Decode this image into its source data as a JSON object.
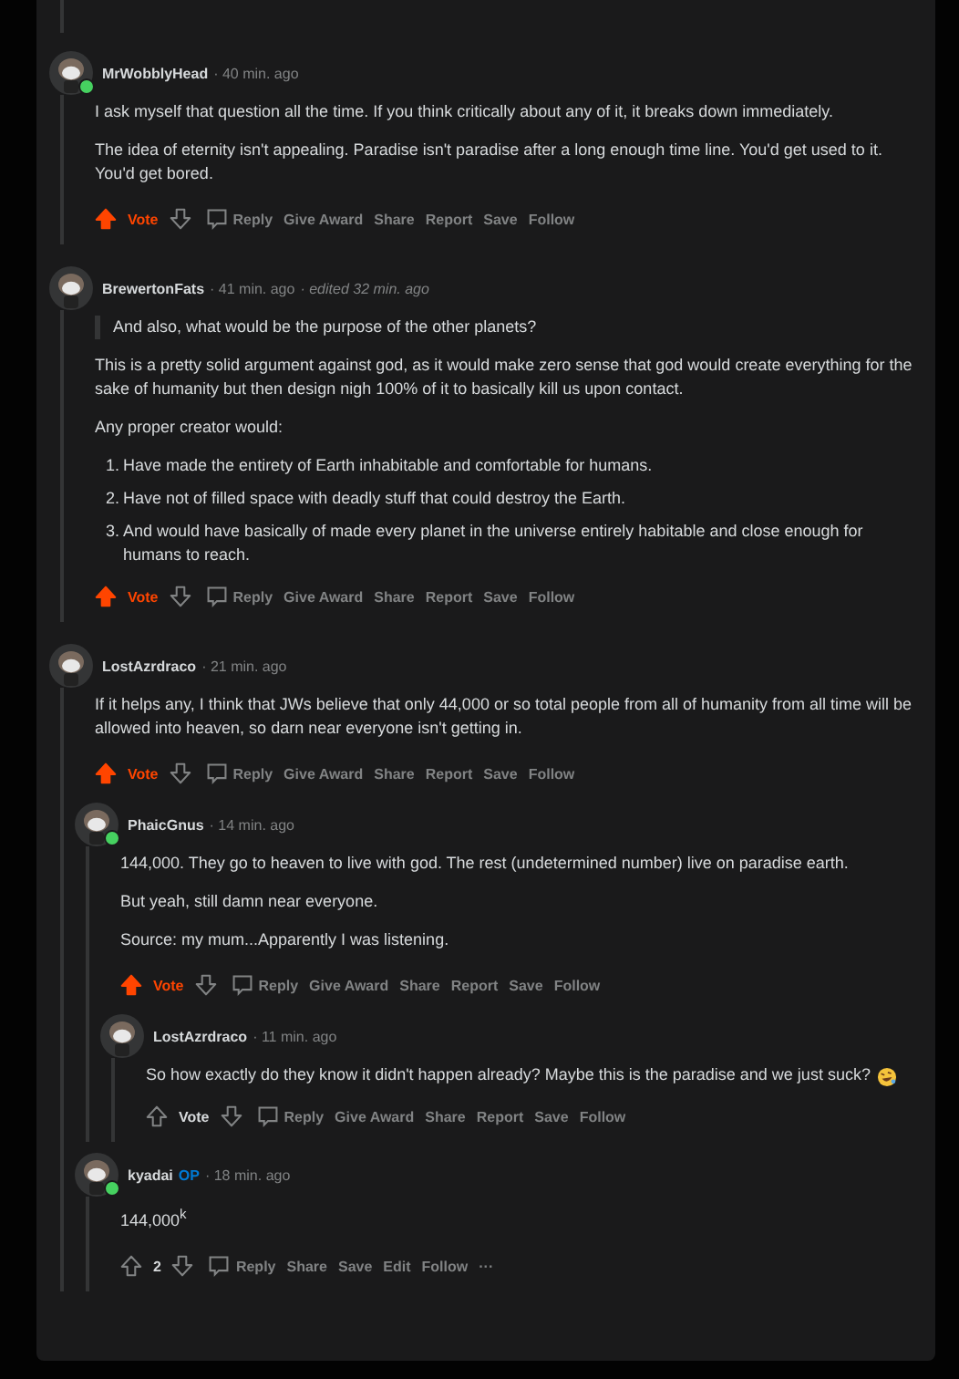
{
  "comments": [
    {
      "author": "MrWobblyHead",
      "time": "· 40 min. ago",
      "online": true,
      "upvoted": true,
      "score": "Vote",
      "body": [
        {
          "kind": "p",
          "text": "I ask myself that question all the time. If you think critically about any of it, it breaks down immediately."
        },
        {
          "kind": "p",
          "text": "The idea of eternity isn't appealing. Paradise isn't paradise after a long enough time line. You'd get used to it. You'd get bored."
        }
      ],
      "actions": [
        "Reply",
        "Give Award",
        "Share",
        "Report",
        "Save",
        "Follow"
      ]
    },
    {
      "author": "BrewertonFats",
      "time": "· 41 min. ago",
      "edited": "· edited 32 min. ago",
      "online": false,
      "upvoted": true,
      "score": "Vote",
      "body": [
        {
          "kind": "quote",
          "text": "And also, what would be the purpose of the other planets?"
        },
        {
          "kind": "p",
          "text": "This is a pretty solid argument against god, as it would make zero sense that god would create everything for the sake of humanity but then design nigh 100% of it to basically kill us upon contact."
        },
        {
          "kind": "p",
          "text": "Any proper creator would:"
        },
        {
          "kind": "ol",
          "items": [
            {
              "num": "1.",
              "text": "Have made the entirety of Earth inhabitable and comfortable for humans."
            },
            {
              "num": "2.",
              "text": "Have not of filled space with deadly stuff that could destroy the Earth."
            },
            {
              "num": "3.",
              "text": "And would have basically of made every planet in the universe entirely habitable and close enough for humans to reach."
            }
          ]
        }
      ],
      "actions": [
        "Reply",
        "Give Award",
        "Share",
        "Report",
        "Save",
        "Follow"
      ]
    },
    {
      "author": "LostAzrdraco",
      "time": "· 21 min. ago",
      "online": false,
      "upvoted": true,
      "score": "Vote",
      "body": [
        {
          "kind": "p",
          "text": "If it helps any, I think that JWs believe that only 44,000 or so total people from all of humanity from all time will be allowed into heaven, so darn near everyone isn't getting in."
        }
      ],
      "actions": [
        "Reply",
        "Give Award",
        "Share",
        "Report",
        "Save",
        "Follow"
      ],
      "children": [
        {
          "author": "PhaicGnus",
          "time": "· 14 min. ago",
          "online": true,
          "upvoted": true,
          "score": "Vote",
          "body": [
            {
              "kind": "p",
              "text": "144,000. They go to heaven to live with god. The rest (undetermined number) live on paradise earth."
            },
            {
              "kind": "p",
              "text": "But yeah, still damn near everyone."
            },
            {
              "kind": "p",
              "text": "Source: my mum...Apparently I was listening."
            }
          ],
          "actions": [
            "Reply",
            "Give Award",
            "Share",
            "Report",
            "Save",
            "Follow"
          ],
          "children": [
            {
              "author": "LostAzrdraco",
              "time": "· 11 min. ago",
              "online": false,
              "upvoted": false,
              "score": "Vote",
              "body": [
                {
                  "kind": "p_emoji",
                  "text": "So how exactly do they know it didn't happen already? Maybe this is the paradise and we just suck?"
                }
              ],
              "actions": [
                "Reply",
                "Give Award",
                "Share",
                "Report",
                "Save",
                "Follow"
              ]
            }
          ]
        },
        {
          "author": "kyadai",
          "op_badge": "OP",
          "time": "· 18 min. ago",
          "online": true,
          "upvoted": false,
          "score": "2",
          "body": [
            {
              "kind": "p",
              "text": "144,000$^{k}$"
            }
          ],
          "actions": [
            "Reply",
            "Share",
            "Save",
            "Edit",
            "Follow",
            "···"
          ]
        }
      ]
    }
  ]
}
